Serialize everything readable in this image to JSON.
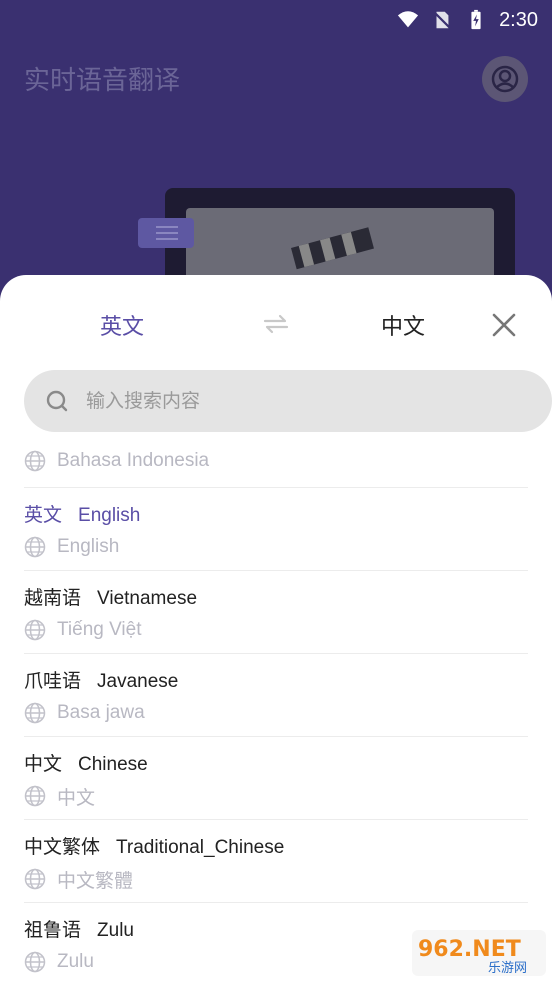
{
  "status_bar": {
    "time": "2:30"
  },
  "app": {
    "title": "实时语音翻译"
  },
  "language_bar": {
    "source": "英文",
    "target": "中文"
  },
  "search": {
    "placeholder": "输入搜索内容",
    "value": ""
  },
  "languages": [
    {
      "native": "Bahasa Indonesia"
    },
    {
      "name_zh": "英文",
      "name_en": "English",
      "native": "English",
      "selected": true
    },
    {
      "name_zh": "越南语",
      "name_en": "Vietnamese",
      "native": "Tiếng Việt"
    },
    {
      "name_zh": "爪哇语",
      "name_en": "Javanese",
      "native": "Basa jawa"
    },
    {
      "name_zh": "中文",
      "name_en": "Chinese",
      "native": "中文"
    },
    {
      "name_zh": "中文繁体",
      "name_en": "Traditional_Chinese",
      "native": "中文繁體"
    },
    {
      "name_zh": "祖鲁语",
      "name_en": "Zulu",
      "native": "Zulu"
    }
  ],
  "watermark": {
    "text_big": "962.NET",
    "text_small": "乐游网"
  },
  "colors": {
    "accent": "#5a4ea6",
    "background": "#3a3070",
    "search_bg": "#e4e4e4"
  }
}
